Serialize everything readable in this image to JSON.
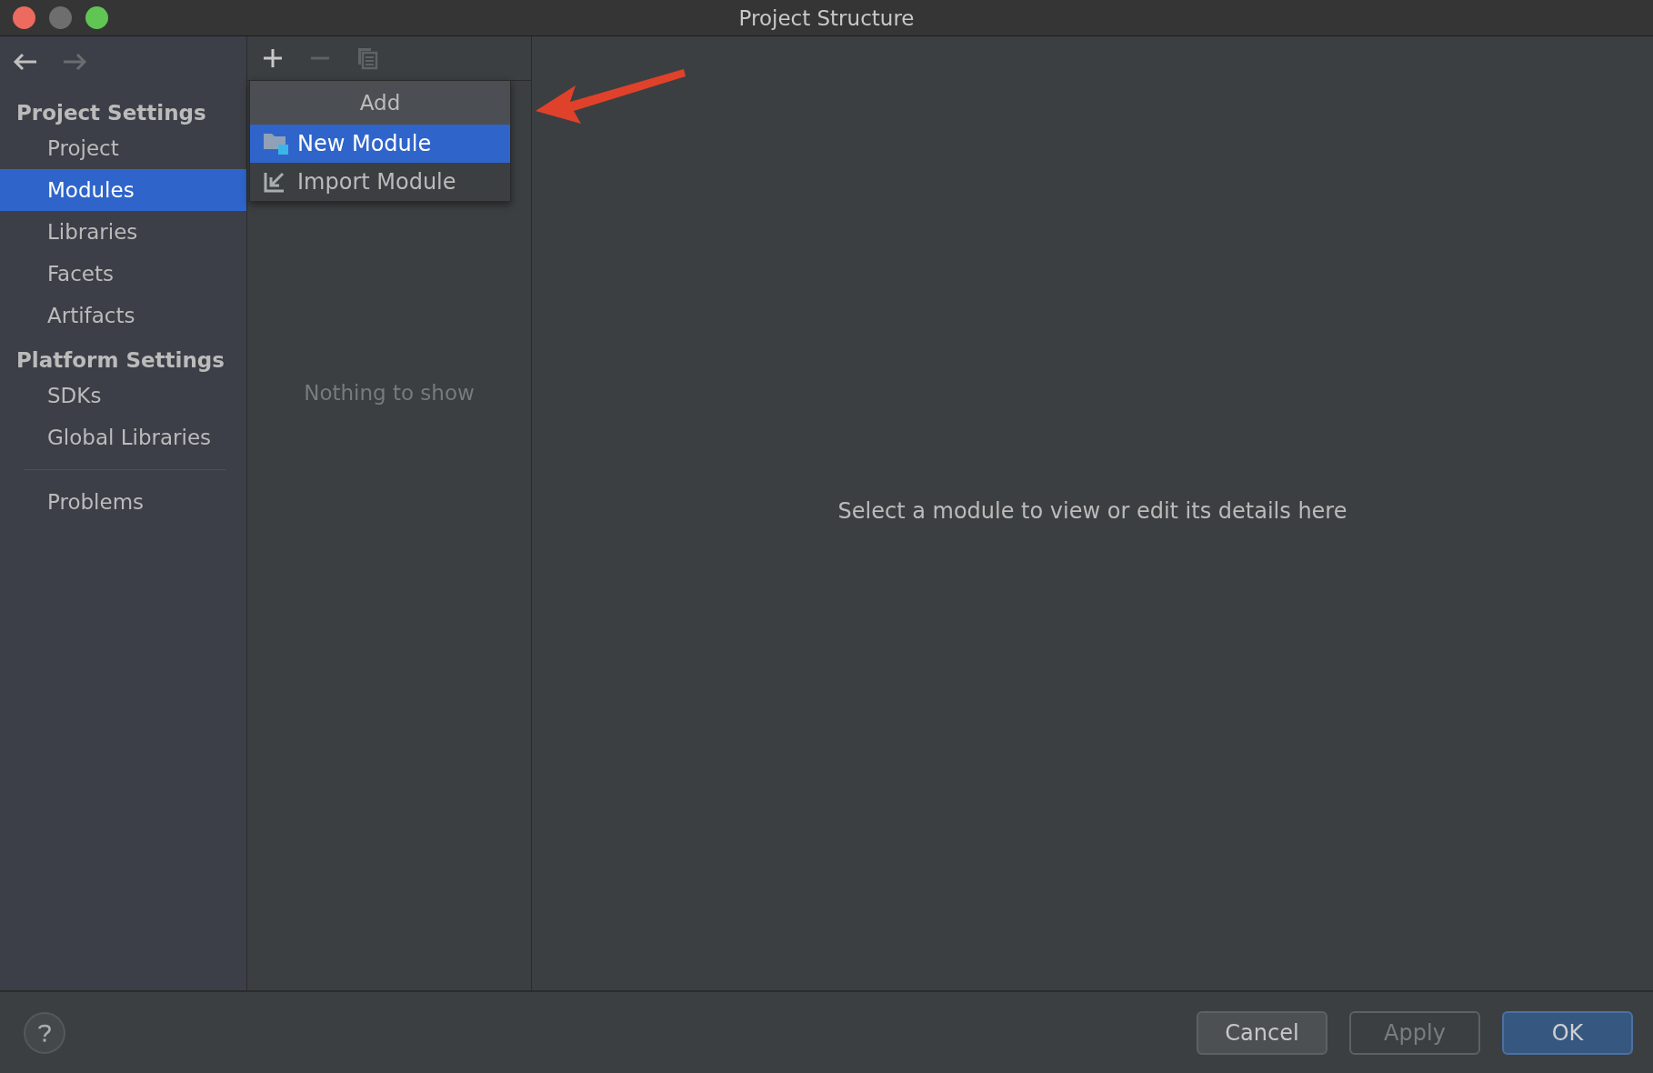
{
  "window": {
    "title": "Project Structure"
  },
  "navigation": [
    {
      "kind": "back",
      "disabled": false
    },
    {
      "kind": "forward",
      "disabled": true
    }
  ],
  "sidebar": {
    "sections": [
      {
        "title": "Project Settings",
        "items": [
          {
            "label": "Project",
            "selected": false
          },
          {
            "label": "Modules",
            "selected": true
          },
          {
            "label": "Libraries",
            "selected": false
          },
          {
            "label": "Facets",
            "selected": false
          },
          {
            "label": "Artifacts",
            "selected": false
          }
        ]
      },
      {
        "title": "Platform Settings",
        "items": [
          {
            "label": "SDKs",
            "selected": false
          },
          {
            "label": "Global Libraries",
            "selected": false
          }
        ]
      }
    ],
    "footer_items": [
      {
        "label": "Problems",
        "selected": false
      }
    ]
  },
  "toolbar": [
    {
      "kind": "add",
      "disabled": false
    },
    {
      "kind": "remove",
      "disabled": true
    },
    {
      "kind": "copy",
      "disabled": true
    }
  ],
  "add_menu": {
    "title": "Add",
    "items": [
      {
        "kind": "new",
        "label": "New Module",
        "selected": true
      },
      {
        "kind": "import",
        "label": "Import Module",
        "selected": false
      }
    ]
  },
  "module_list": {
    "empty_text": "Nothing to show"
  },
  "details": {
    "empty_text": "Select a module to view or edit its details here"
  },
  "buttons": [
    {
      "label": "Cancel",
      "kind": "normal",
      "disabled": false
    },
    {
      "label": "Apply",
      "kind": "normal",
      "disabled": true
    },
    {
      "label": "OK",
      "kind": "default",
      "disabled": false
    }
  ]
}
